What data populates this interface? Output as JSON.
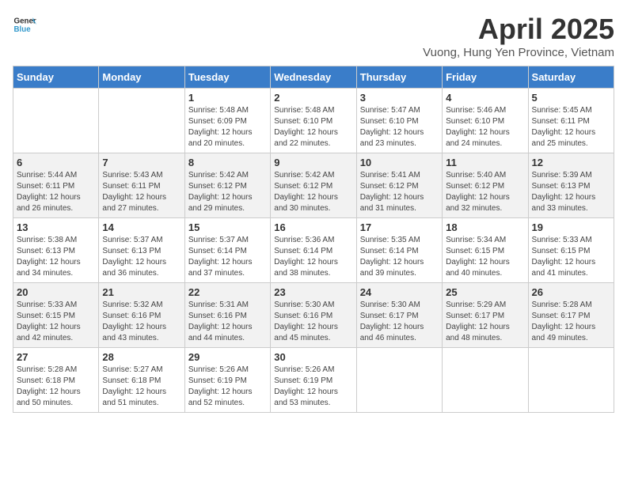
{
  "header": {
    "logo_general": "General",
    "logo_blue": "Blue",
    "title": "April 2025",
    "subtitle": "Vuong, Hung Yen Province, Vietnam"
  },
  "weekdays": [
    "Sunday",
    "Monday",
    "Tuesday",
    "Wednesday",
    "Thursday",
    "Friday",
    "Saturday"
  ],
  "weeks": [
    [
      {
        "day": "",
        "sunrise": "",
        "sunset": "",
        "daylight": ""
      },
      {
        "day": "",
        "sunrise": "",
        "sunset": "",
        "daylight": ""
      },
      {
        "day": "1",
        "sunrise": "Sunrise: 5:48 AM",
        "sunset": "Sunset: 6:09 PM",
        "daylight": "Daylight: 12 hours and 20 minutes."
      },
      {
        "day": "2",
        "sunrise": "Sunrise: 5:48 AM",
        "sunset": "Sunset: 6:10 PM",
        "daylight": "Daylight: 12 hours and 22 minutes."
      },
      {
        "day": "3",
        "sunrise": "Sunrise: 5:47 AM",
        "sunset": "Sunset: 6:10 PM",
        "daylight": "Daylight: 12 hours and 23 minutes."
      },
      {
        "day": "4",
        "sunrise": "Sunrise: 5:46 AM",
        "sunset": "Sunset: 6:10 PM",
        "daylight": "Daylight: 12 hours and 24 minutes."
      },
      {
        "day": "5",
        "sunrise": "Sunrise: 5:45 AM",
        "sunset": "Sunset: 6:11 PM",
        "daylight": "Daylight: 12 hours and 25 minutes."
      }
    ],
    [
      {
        "day": "6",
        "sunrise": "Sunrise: 5:44 AM",
        "sunset": "Sunset: 6:11 PM",
        "daylight": "Daylight: 12 hours and 26 minutes."
      },
      {
        "day": "7",
        "sunrise": "Sunrise: 5:43 AM",
        "sunset": "Sunset: 6:11 PM",
        "daylight": "Daylight: 12 hours and 27 minutes."
      },
      {
        "day": "8",
        "sunrise": "Sunrise: 5:42 AM",
        "sunset": "Sunset: 6:12 PM",
        "daylight": "Daylight: 12 hours and 29 minutes."
      },
      {
        "day": "9",
        "sunrise": "Sunrise: 5:42 AM",
        "sunset": "Sunset: 6:12 PM",
        "daylight": "Daylight: 12 hours and 30 minutes."
      },
      {
        "day": "10",
        "sunrise": "Sunrise: 5:41 AM",
        "sunset": "Sunset: 6:12 PM",
        "daylight": "Daylight: 12 hours and 31 minutes."
      },
      {
        "day": "11",
        "sunrise": "Sunrise: 5:40 AM",
        "sunset": "Sunset: 6:12 PM",
        "daylight": "Daylight: 12 hours and 32 minutes."
      },
      {
        "day": "12",
        "sunrise": "Sunrise: 5:39 AM",
        "sunset": "Sunset: 6:13 PM",
        "daylight": "Daylight: 12 hours and 33 minutes."
      }
    ],
    [
      {
        "day": "13",
        "sunrise": "Sunrise: 5:38 AM",
        "sunset": "Sunset: 6:13 PM",
        "daylight": "Daylight: 12 hours and 34 minutes."
      },
      {
        "day": "14",
        "sunrise": "Sunrise: 5:37 AM",
        "sunset": "Sunset: 6:13 PM",
        "daylight": "Daylight: 12 hours and 36 minutes."
      },
      {
        "day": "15",
        "sunrise": "Sunrise: 5:37 AM",
        "sunset": "Sunset: 6:14 PM",
        "daylight": "Daylight: 12 hours and 37 minutes."
      },
      {
        "day": "16",
        "sunrise": "Sunrise: 5:36 AM",
        "sunset": "Sunset: 6:14 PM",
        "daylight": "Daylight: 12 hours and 38 minutes."
      },
      {
        "day": "17",
        "sunrise": "Sunrise: 5:35 AM",
        "sunset": "Sunset: 6:14 PM",
        "daylight": "Daylight: 12 hours and 39 minutes."
      },
      {
        "day": "18",
        "sunrise": "Sunrise: 5:34 AM",
        "sunset": "Sunset: 6:15 PM",
        "daylight": "Daylight: 12 hours and 40 minutes."
      },
      {
        "day": "19",
        "sunrise": "Sunrise: 5:33 AM",
        "sunset": "Sunset: 6:15 PM",
        "daylight": "Daylight: 12 hours and 41 minutes."
      }
    ],
    [
      {
        "day": "20",
        "sunrise": "Sunrise: 5:33 AM",
        "sunset": "Sunset: 6:15 PM",
        "daylight": "Daylight: 12 hours and 42 minutes."
      },
      {
        "day": "21",
        "sunrise": "Sunrise: 5:32 AM",
        "sunset": "Sunset: 6:16 PM",
        "daylight": "Daylight: 12 hours and 43 minutes."
      },
      {
        "day": "22",
        "sunrise": "Sunrise: 5:31 AM",
        "sunset": "Sunset: 6:16 PM",
        "daylight": "Daylight: 12 hours and 44 minutes."
      },
      {
        "day": "23",
        "sunrise": "Sunrise: 5:30 AM",
        "sunset": "Sunset: 6:16 PM",
        "daylight": "Daylight: 12 hours and 45 minutes."
      },
      {
        "day": "24",
        "sunrise": "Sunrise: 5:30 AM",
        "sunset": "Sunset: 6:17 PM",
        "daylight": "Daylight: 12 hours and 46 minutes."
      },
      {
        "day": "25",
        "sunrise": "Sunrise: 5:29 AM",
        "sunset": "Sunset: 6:17 PM",
        "daylight": "Daylight: 12 hours and 48 minutes."
      },
      {
        "day": "26",
        "sunrise": "Sunrise: 5:28 AM",
        "sunset": "Sunset: 6:17 PM",
        "daylight": "Daylight: 12 hours and 49 minutes."
      }
    ],
    [
      {
        "day": "27",
        "sunrise": "Sunrise: 5:28 AM",
        "sunset": "Sunset: 6:18 PM",
        "daylight": "Daylight: 12 hours and 50 minutes."
      },
      {
        "day": "28",
        "sunrise": "Sunrise: 5:27 AM",
        "sunset": "Sunset: 6:18 PM",
        "daylight": "Daylight: 12 hours and 51 minutes."
      },
      {
        "day": "29",
        "sunrise": "Sunrise: 5:26 AM",
        "sunset": "Sunset: 6:19 PM",
        "daylight": "Daylight: 12 hours and 52 minutes."
      },
      {
        "day": "30",
        "sunrise": "Sunrise: 5:26 AM",
        "sunset": "Sunset: 6:19 PM",
        "daylight": "Daylight: 12 hours and 53 minutes."
      },
      {
        "day": "",
        "sunrise": "",
        "sunset": "",
        "daylight": ""
      },
      {
        "day": "",
        "sunrise": "",
        "sunset": "",
        "daylight": ""
      },
      {
        "day": "",
        "sunrise": "",
        "sunset": "",
        "daylight": ""
      }
    ]
  ]
}
